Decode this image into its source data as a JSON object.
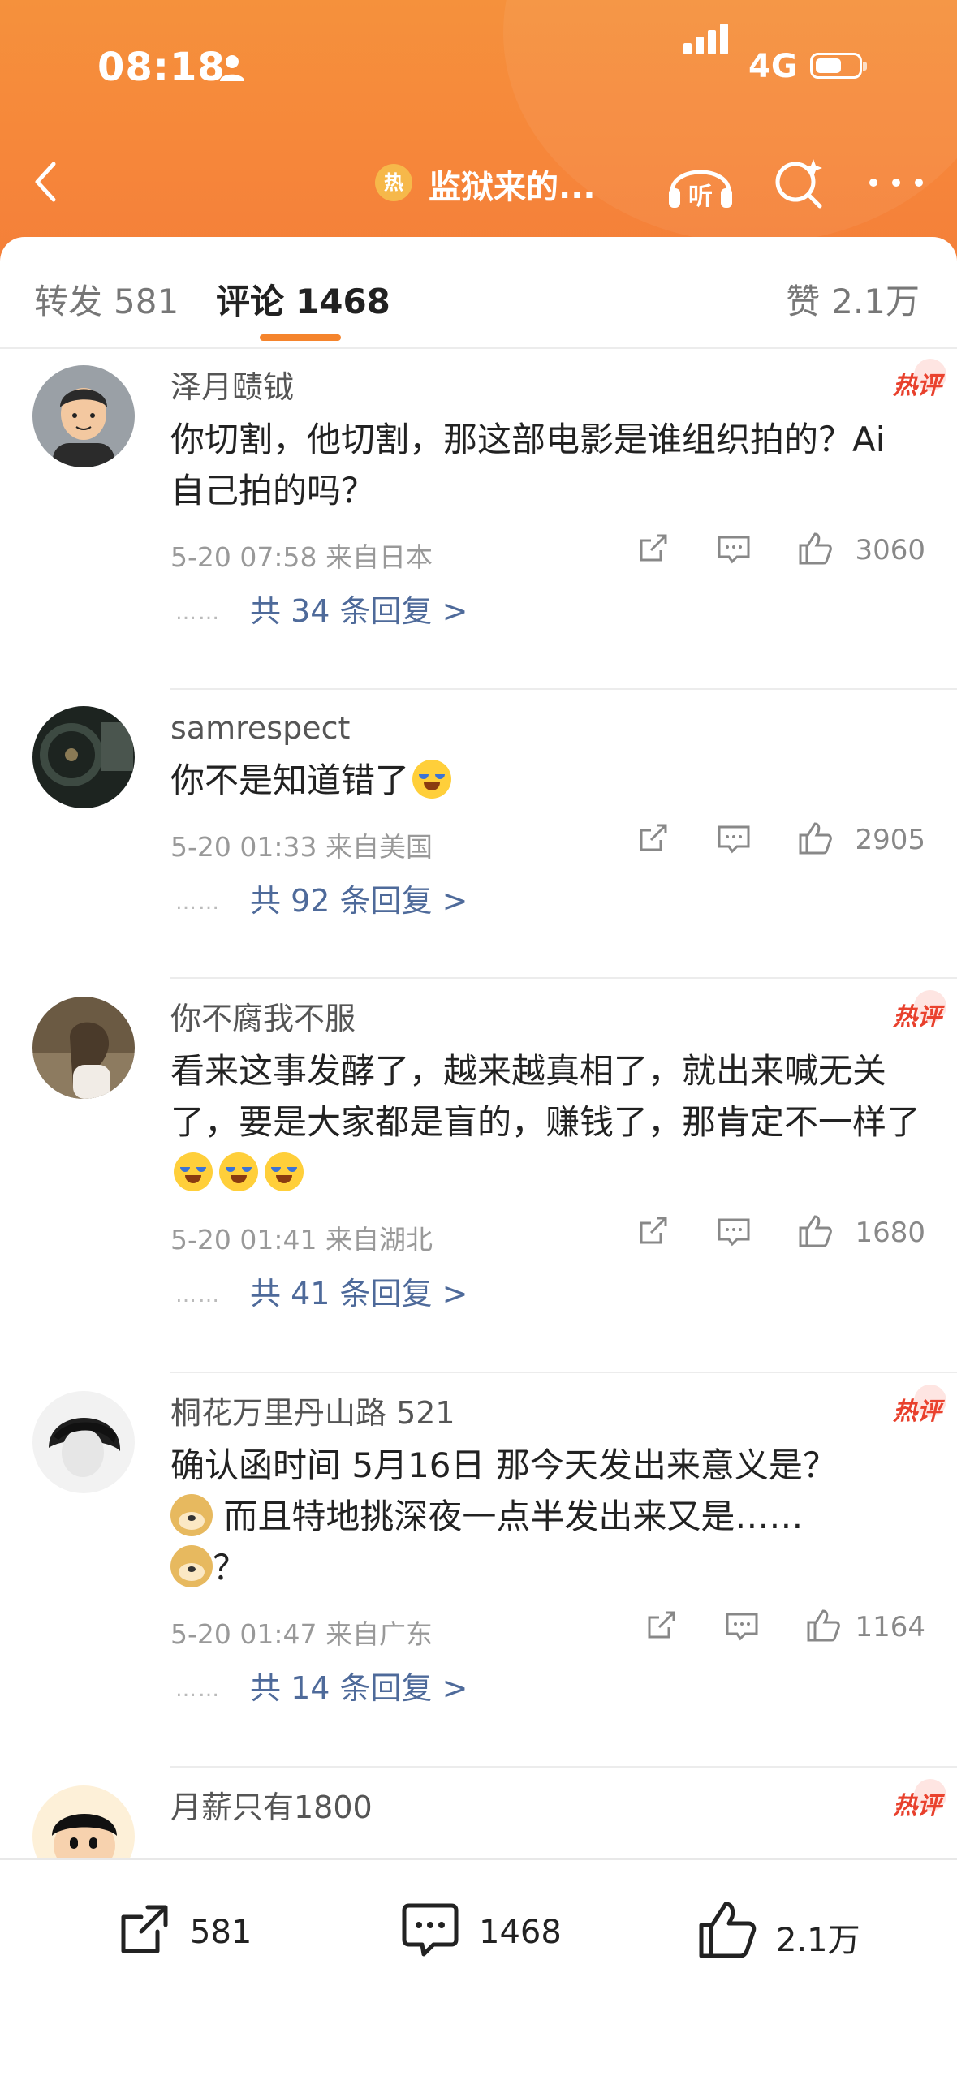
{
  "status_bar": {
    "time": "08:18",
    "network": "4G",
    "battery_level": 0.6
  },
  "nav": {
    "title": "监狱来的...",
    "hot_badge": "热",
    "listen_label": "听"
  },
  "tabs": {
    "repost_label": "转发",
    "repost_count": "581",
    "comment_label": "评论",
    "comment_count": "1468",
    "like_label": "赞",
    "like_count": "2.1万"
  },
  "comments": [
    {
      "user": "泽月赜钺",
      "hot": "热评",
      "text": "你切割，他切割，那这部电影是谁组织拍的？Ai 自己拍的吗？",
      "time": "5-20 07:58",
      "location": "来自日本",
      "likes": "3060",
      "dots": "……",
      "replies": "共 34 条回复 >"
    },
    {
      "user": "samrespect",
      "hot": "",
      "text": "你不是知道错了",
      "time": "5-20 01:33",
      "location": "来自美国",
      "likes": "2905",
      "dots": "……",
      "replies": "共 92 条回复 >"
    },
    {
      "user": "你不腐我不服",
      "hot": "热评",
      "text": "看来这事发酵了，越来越真相了，就出来喊无关了，要是大家都是盲的，赚钱了，那肯定不一样了",
      "time": "5-20 01:41",
      "location": "来自湖北",
      "likes": "1680",
      "dots": "……",
      "replies": "共 41 条回复 >"
    },
    {
      "user": "桐花万里丹山路 521",
      "hot": "热评",
      "text_a": "确认函时间 5月16日 那今天发出来意义是？",
      "text_b": " 而且特地挑深夜一点半发出来又是……",
      "text_c": "？",
      "time": "5-20 01:47",
      "location": "来自广东",
      "likes": "1164",
      "dots": "……",
      "replies": "共 14 条回复 >"
    },
    {
      "user": "月薪只有1800",
      "hot": "热评"
    }
  ],
  "bottom_bar": {
    "repost": "581",
    "comment": "1468",
    "like": "2.1万"
  }
}
